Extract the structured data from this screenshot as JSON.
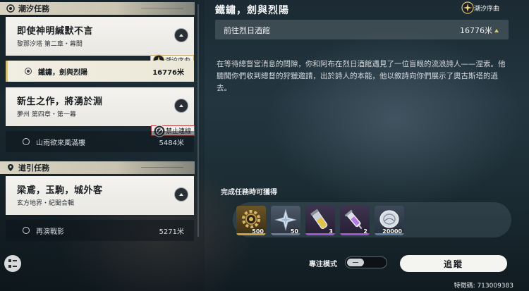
{
  "left_panel": {
    "section_tidal": {
      "label": "潮汐任務"
    },
    "quest1": {
      "title": "即使神明緘默不言",
      "subtitle": "黎那汐塔 第二章・幕間",
      "badge": "潮汐序曲",
      "step": {
        "name": "鐵鏽，劍與烈陽",
        "distance": "16776米"
      }
    },
    "quest2": {
      "title": "新生之作，將湧於淵",
      "subtitle": "夢州 第四章・第一幕",
      "badge": "禁止連線",
      "step": {
        "name": "山雨欲來風滿樓",
        "distance": "5484米"
      }
    },
    "section_guide": {
      "label": "道引任務"
    },
    "quest3": {
      "title": "梁鳶，玉駒，城外客",
      "subtitle": "玄方地界・紀聞合輯",
      "step": {
        "name": "再演戰影",
        "distance": "5271米"
      }
    }
  },
  "detail": {
    "title": "鐵鏽，劍與烈陽",
    "badge": "潮汐序曲",
    "target": {
      "name": "前往烈日酒館",
      "distance": "16776米"
    },
    "description": "在等待總督宮消息的間隙，你和阿布在烈日酒館遇見了一位盲眼的流浪詩人——涅索。他聽聞你們收到總督的狩獵邀請，出於詩人的本能，他以敘詩向你們展示了奧古斯塔的過去。",
    "rewards_label": "完成任務時可獲得",
    "rewards": [
      {
        "icon": "gear-icon",
        "qty": "500",
        "rarity_color": "#c9a24a"
      },
      {
        "icon": "crystal-star-icon",
        "qty": "50",
        "rarity_color": "#6a7e9a"
      },
      {
        "icon": "potion-vial-icon",
        "qty": "3",
        "rarity_color": "#9a5ad6"
      },
      {
        "icon": "syringe-icon",
        "qty": "2",
        "rarity_color": "#9a5ad6"
      },
      {
        "icon": "shell-coin-icon",
        "qty": "20000",
        "rarity_color": "#5a7ea6"
      }
    ],
    "focus_mode_label": "專注模式",
    "track_label": "追蹤"
  },
  "footer": {
    "uid": "特徵碼: 713009383"
  },
  "colors": {
    "accent_gold": "#d9c27a",
    "forbidden_red": "#c23a3a",
    "card_bg": "#f1f0ec"
  }
}
